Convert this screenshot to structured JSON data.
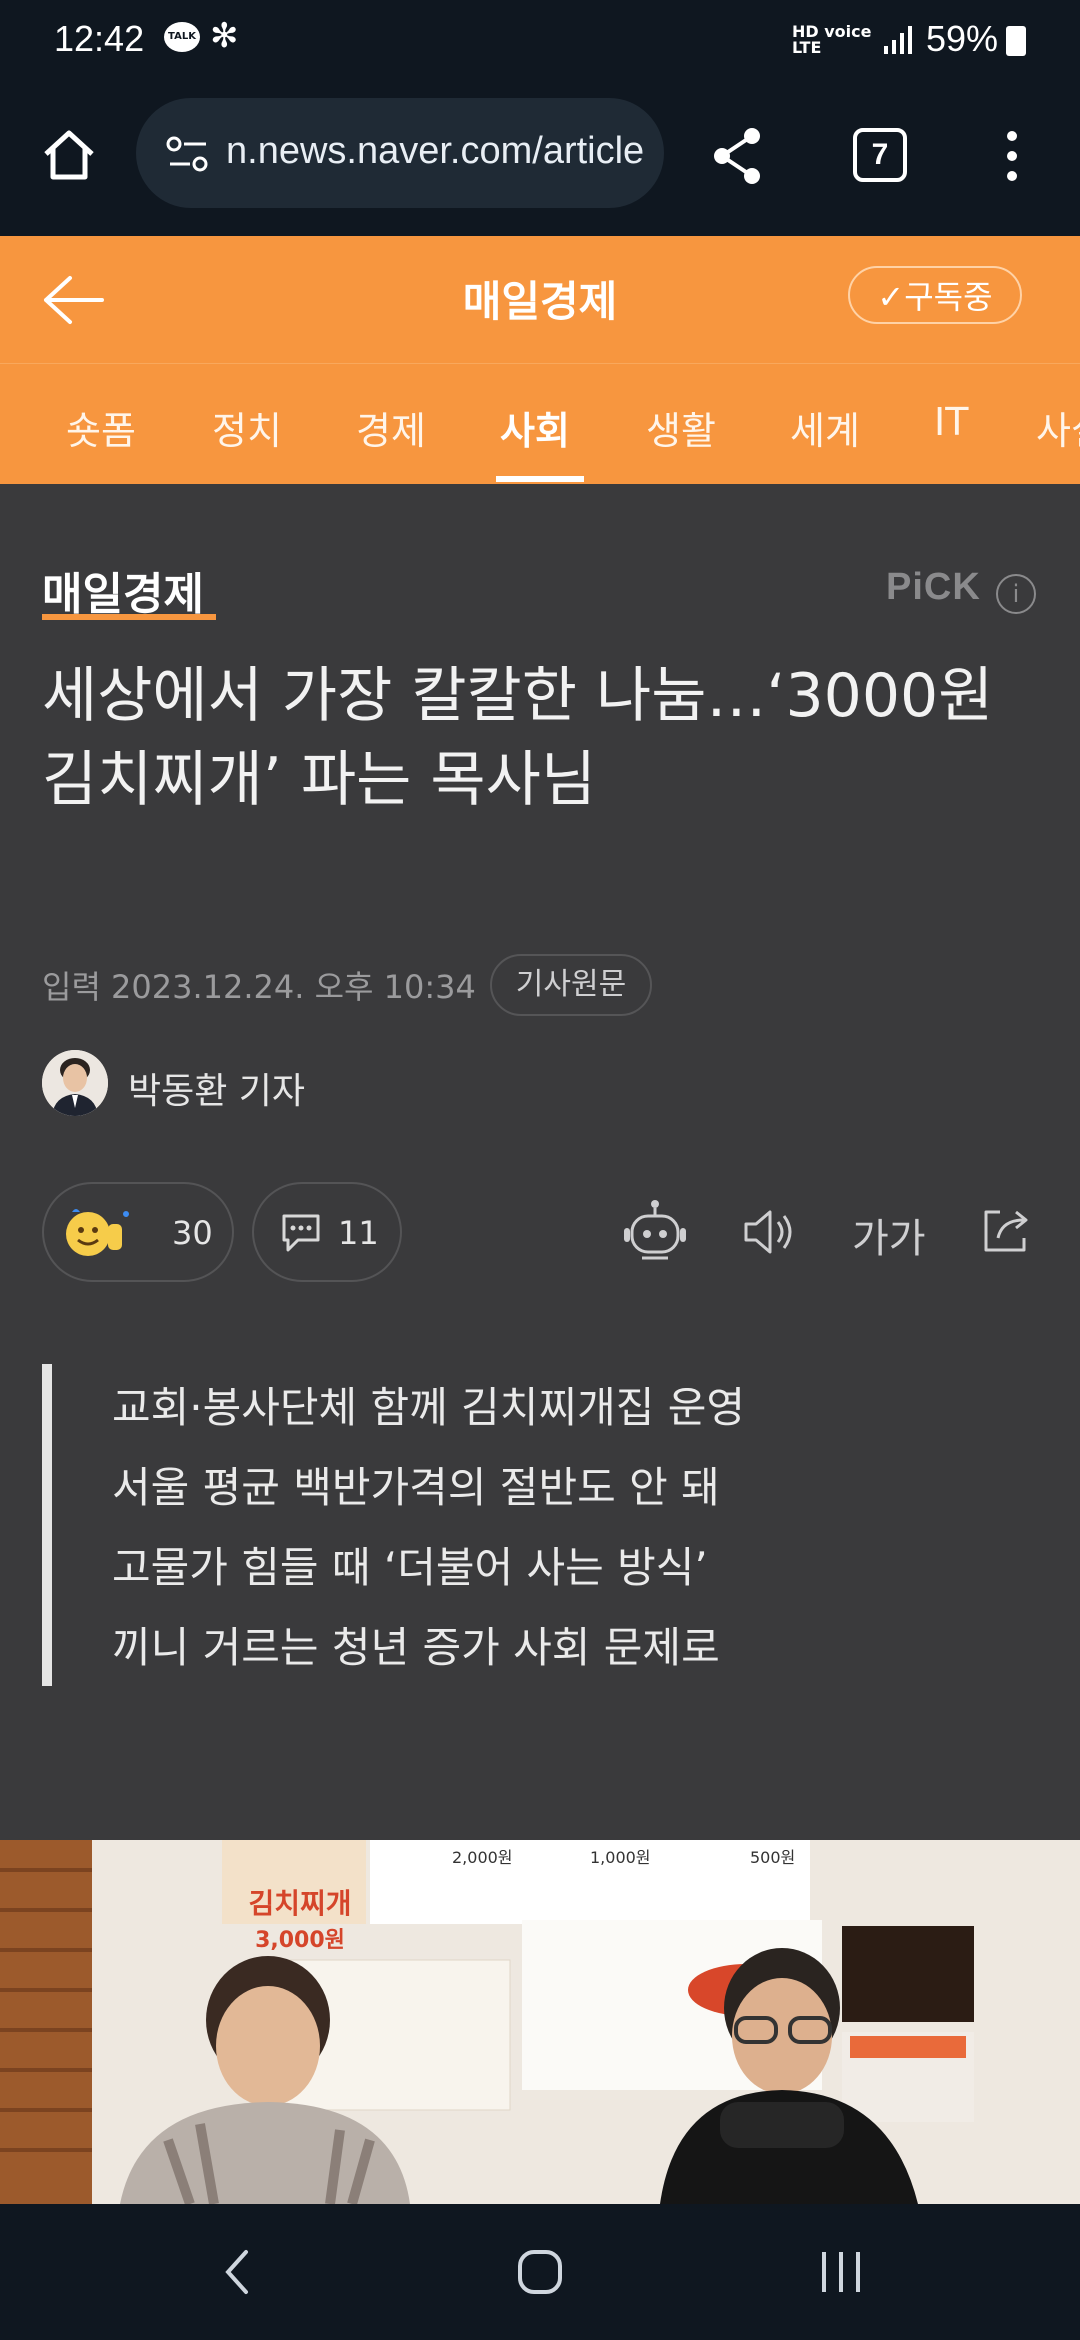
{
  "status": {
    "time": "12:42",
    "network": "HD voice LTE",
    "battery": "59%"
  },
  "browser": {
    "url": "n.news.naver.com/article",
    "tab_count": "7"
  },
  "header": {
    "press_name": "매일경제",
    "subscribe_label": "구독중"
  },
  "tabs": [
    {
      "label": "숏폼"
    },
    {
      "label": "정치"
    },
    {
      "label": "경제"
    },
    {
      "label": "사회"
    },
    {
      "label": "생활"
    },
    {
      "label": "세계"
    },
    {
      "label": "IT"
    },
    {
      "label": "사설"
    }
  ],
  "article": {
    "press_logo": "매일경제",
    "pick_label": "PiCK",
    "pick_info": "i",
    "headline": "세상에서 가장 칼칼한 나눔…‘3000원 김치찌개’ 파는 목사님",
    "published": "입력 2023.12.24. 오후 10:34",
    "original_button": "기사원문",
    "reporter": "박동환 기자",
    "reaction_count": "30",
    "comment_count": "11",
    "font_size_label": "가가",
    "summary": [
      "교회·봉사단체 함께 김치찌개집 운영",
      "서울 평균 백반가격의 절반도 안 돼",
      "고물가 힘들 때 ‘더불어 사는 방식’",
      "끼니 거르는 청년 증가 사회 문제로"
    ]
  },
  "photo": {
    "sign_text": "김치찌개",
    "sign_price": "3,000원",
    "price_items": [
      "2,000원",
      "1,000원",
      "500원"
    ]
  },
  "colors": {
    "brand_orange": "#f7963f",
    "dark_bg": "#3a3a3c",
    "chrome_bg": "#0f1720"
  }
}
